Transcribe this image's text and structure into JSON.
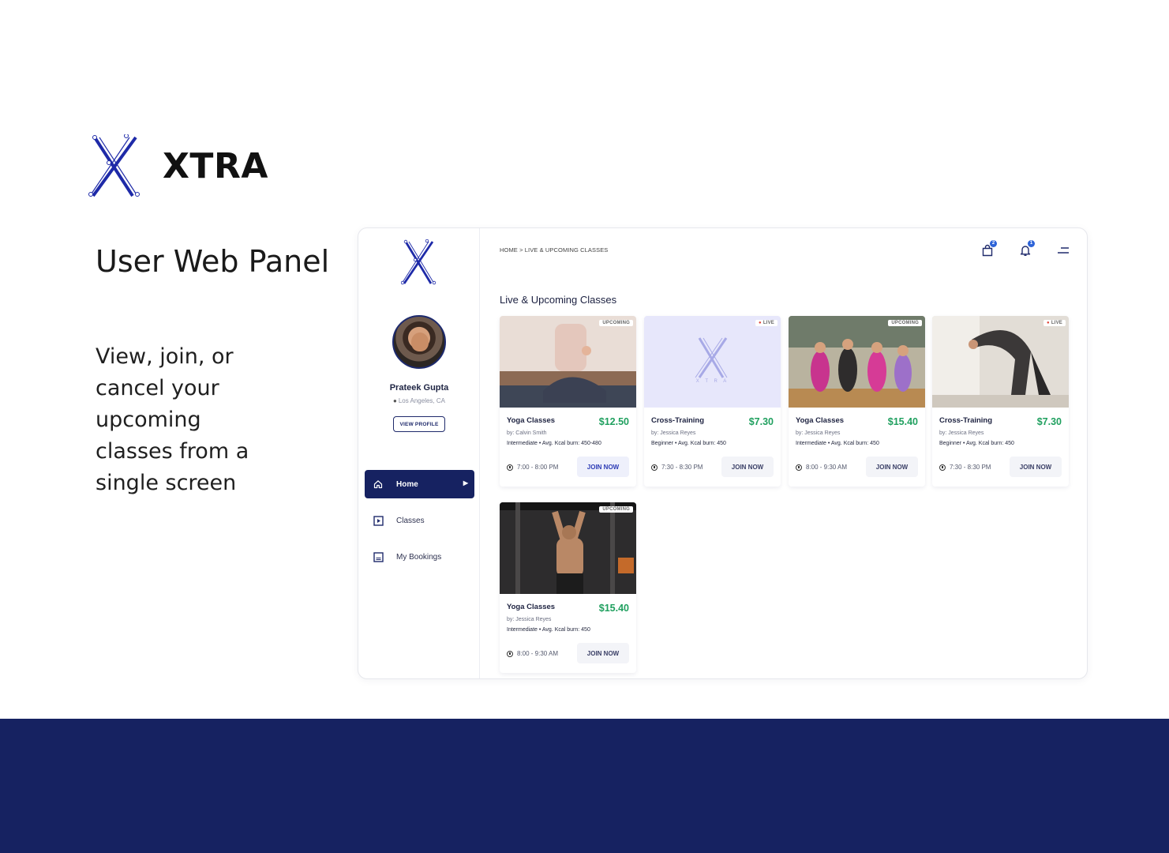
{
  "brand": {
    "name": "XTRA"
  },
  "hero": {
    "headline": "User Web Panel",
    "subline": "View, join, or cancel your upcoming classes from a single screen"
  },
  "sidebar": {
    "user": {
      "name": "Prateek Gupta",
      "location": "Los Angeles, CA"
    },
    "view_profile_label": "VIEW PROFILE",
    "items": [
      {
        "label": "Home",
        "icon": "home-icon",
        "active": true
      },
      {
        "label": "Classes",
        "icon": "play-square-icon",
        "active": false
      },
      {
        "label": "My Bookings",
        "icon": "bookings-icon",
        "active": false
      }
    ]
  },
  "header": {
    "breadcrumb": "HOME > LIVE & UPCOMING CLASSES",
    "cart_badge": "2",
    "bell_badge": "1"
  },
  "main": {
    "section_title": "Live & Upcoming Classes",
    "cards": [
      {
        "title": "Yoga Classes",
        "price": "$12.50",
        "by": "by: Calvin Smith",
        "meta": "Intermediate • Avg. Kcal burn: 450-480",
        "time": "7:00 - 8:00 PM",
        "status": "UPCOMING",
        "join": "JOIN NOW"
      },
      {
        "title": "Cross-Training",
        "price": "$7.30",
        "by": "by: Jessica Reyes",
        "meta": "Beginner • Avg. Kcal burn: 450",
        "time": "7:30 - 8:30 PM",
        "status": "LIVE",
        "join": "JOIN NOW"
      },
      {
        "title": "Yoga Classes",
        "price": "$15.40",
        "by": "by: Jessica Reyes",
        "meta": "Intermediate • Avg. Kcal burn: 450",
        "time": "8:00 - 9:30 AM",
        "status": "UPCOMING",
        "join": "JOIN NOW"
      },
      {
        "title": "Cross-Training",
        "price": "$7.30",
        "by": "by: Jessica Reyes",
        "meta": "Beginner • Avg. Kcal burn: 450",
        "time": "7:30 - 8:30 PM",
        "status": "LIVE",
        "join": "JOIN NOW"
      },
      {
        "title": "Yoga Classes",
        "price": "$15.40",
        "by": "by: Jessica Reyes",
        "meta": "Intermediate • Avg. Kcal burn: 450",
        "time": "8:00 - 9:30 AM",
        "status": "UPCOMING",
        "join": "JOIN NOW"
      }
    ],
    "placeholder_logo_text": "X T R A"
  },
  "colors": {
    "navy": "#162261",
    "price_green": "#20a05f",
    "live_red": "#e0463a"
  }
}
